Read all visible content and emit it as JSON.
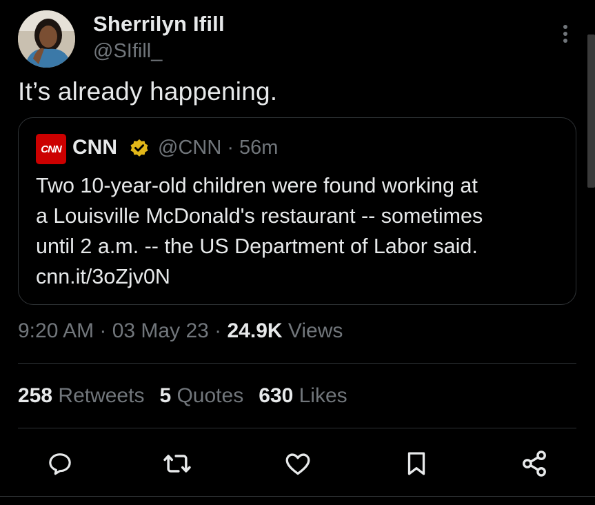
{
  "author": {
    "name": "Sherrilyn Ifill",
    "handle": "@SIfill_",
    "avatar_icon": "avatar"
  },
  "tweet": {
    "text": "It’s already happening."
  },
  "quoted_tweet": {
    "logo_text": "CNN",
    "name": "CNN",
    "verified_icon": "verified-badge-icon",
    "verified_color": "#e2b719",
    "handle_time": "@CNN · 56m",
    "body_lines": [
      "Two 10-year-old children were found working at",
      "a Louisville McDonald's restaurant -- sometimes",
      "until 2 a.m. -- the US Department of Labor said.",
      "cnn.it/3oZjv0N"
    ]
  },
  "meta": {
    "time_date": "9:20 AM · 03 May 23 · ",
    "views_count": "24.9K",
    "views_label": " Views"
  },
  "stats": {
    "retweets_count": "258",
    "retweets_label": " Retweets",
    "quotes_count": "5",
    "quotes_label": " Quotes",
    "likes_count": "630",
    "likes_label": " Likes"
  },
  "actions": [
    "reply-icon",
    "retweet-icon",
    "like-icon",
    "bookmark-icon",
    "share-icon"
  ],
  "colors": {
    "background": "#000000",
    "text": "#e7e9ea",
    "secondary": "#71767b",
    "border": "#2f3336",
    "cnn_red": "#cc0000"
  }
}
